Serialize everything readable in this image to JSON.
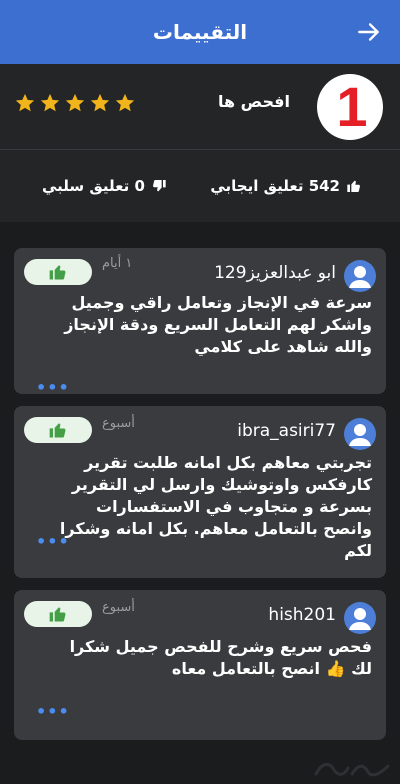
{
  "header": {
    "title": "التقييمات"
  },
  "seller": {
    "name": "افحص ها",
    "logo_text": "1",
    "rating": 5
  },
  "counts": {
    "positive_label": "542 تعليق ايجابي",
    "negative_label": "0 تعليق سلبي"
  },
  "reviews": [
    {
      "username": "ابو عبدالعزيز129",
      "time": "١ أيام",
      "body_lines": [
        "سرعة في الإنجاز وتعامل راقي وجميل",
        "واشكر لهم التعامل السريع ودقة الإنجاز",
        "والله شاهد على كلامي"
      ],
      "more": "•••"
    },
    {
      "username": "ibra_asiri77",
      "time": "أسبوع",
      "body_lines": [
        "تجربتي معاهم بكل امانه طلبت تقرير",
        "كارفكس واوتوشيك وارسل لي التقرير",
        "بسرعة و متجاوب في الاستفسارات",
        "وانصح بالتعامل معاهم. بكل امانه وشكرا",
        "لكم"
      ],
      "more": "•••"
    },
    {
      "username": "hish201",
      "time": "أسبوع",
      "body_lines": [
        "فحص سريع وشرح للفحص جميل شكرا",
        "لك 👍 انصح بالتعامل معاه"
      ],
      "more": "•••"
    }
  ],
  "colors": {
    "header": "#3d6fd0",
    "background": "#1b1c1e",
    "panel": "#242527",
    "card": "#3a3b3e",
    "accent_green": "#43a047",
    "star": "#f2b41b",
    "link": "#4a8cf0"
  }
}
